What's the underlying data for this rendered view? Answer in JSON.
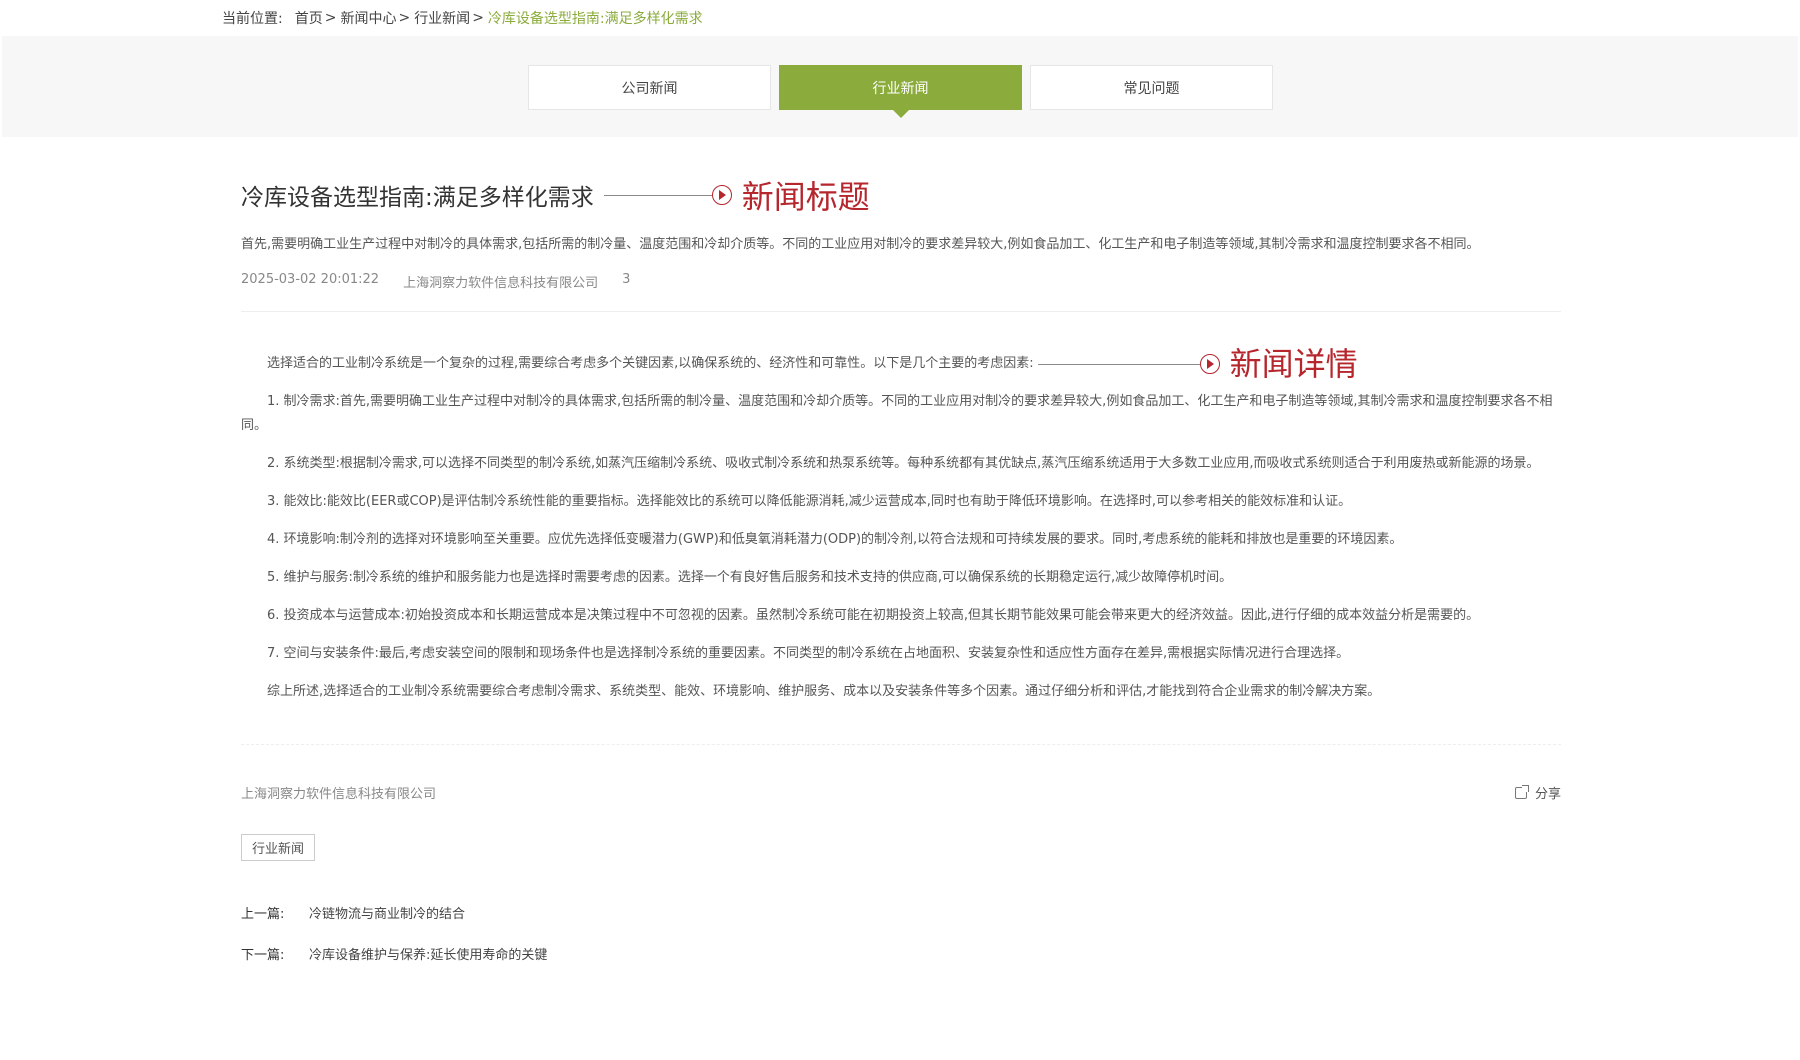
{
  "breadcrumb": {
    "label": "当前位置:",
    "items": [
      "首页",
      "新闻中心",
      "行业新闻"
    ],
    "current": "冷库设备选型指南:满足多样化需求"
  },
  "tabs": [
    {
      "label": "公司新闻",
      "active": false
    },
    {
      "label": "行业新闻",
      "active": true
    },
    {
      "label": "常见问题",
      "active": false
    }
  ],
  "article": {
    "title": "冷库设备选型指南:满足多样化需求",
    "title_annotation": "新闻标题",
    "summary": "首先,需要明确工业生产过程中对制冷的具体需求,包括所需的制冷量、温度范围和冷却介质等。不同的工业应用对制冷的要求差异较大,例如食品加工、化工生产和电子制造等领域,其制冷需求和温度控制要求各不相同。",
    "date": "2025-03-02 20:01:22",
    "author": "上海洞察力软件信息科技有限公司",
    "views": "3",
    "intro": "选择适合的工业制冷系统是一个复杂的过程,需要综合考虑多个关键因素,以确保系统的、经济性和可靠性。以下是几个主要的考虑因素:",
    "detail_annotation": "新闻详情",
    "paragraphs": [
      "1. 制冷需求:首先,需要明确工业生产过程中对制冷的具体需求,包括所需的制冷量、温度范围和冷却介质等。不同的工业应用对制冷的要求差异较大,例如食品加工、化工生产和电子制造等领域,其制冷需求和温度控制要求各不相同。",
      "2. 系统类型:根据制冷需求,可以选择不同类型的制冷系统,如蒸汽压缩制冷系统、吸收式制冷系统和热泵系统等。每种系统都有其优缺点,蒸汽压缩系统适用于大多数工业应用,而吸收式系统则适合于利用废热或新能源的场景。",
      "3. 能效比:能效比(EER或COP)是评估制冷系统性能的重要指标。选择能效比的系统可以降低能源消耗,减少运营成本,同时也有助于降低环境影响。在选择时,可以参考相关的能效标准和认证。",
      "4. 环境影响:制冷剂的选择对环境影响至关重要。应优先选择低变暖潜力(GWP)和低臭氧消耗潜力(ODP)的制冷剂,以符合法规和可持续发展的要求。同时,考虑系统的能耗和排放也是重要的环境因素。",
      "5. 维护与服务:制冷系统的维护和服务能力也是选择时需要考虑的因素。选择一个有良好售后服务和技术支持的供应商,可以确保系统的长期稳定运行,减少故障停机时间。",
      "6. 投资成本与运营成本:初始投资成本和长期运营成本是决策过程中不可忽视的因素。虽然制冷系统可能在初期投资上较高,但其长期节能效果可能会带来更大的经济效益。因此,进行仔细的成本效益分析是需要的。",
      "7. 空间与安装条件:最后,考虑安装空间的限制和现场条件也是选择制冷系统的重要因素。不同类型的制冷系统在占地面积、安装复杂性和适应性方面存在差异,需根据实际情况进行合理选择。",
      "综上所述,选择适合的工业制冷系统需要综合考虑制冷需求、系统类型、能效、环境影响、维护服务、成本以及安装条件等多个因素。通过仔细分析和评估,才能找到符合企业需求的制冷解决方案。"
    ]
  },
  "footer": {
    "company": "上海洞察力软件信息科技有限公司",
    "share_label": "分享",
    "tag": "行业新闻",
    "prev_label": "上一篇:",
    "prev_title": "冷链物流与商业制冷的结合",
    "next_label": "下一篇:",
    "next_title": "冷库设备维护与保养:延长使用寿命的关键"
  },
  "colors": {
    "accent": "#8bac3c",
    "annotation": "#b5262d"
  }
}
